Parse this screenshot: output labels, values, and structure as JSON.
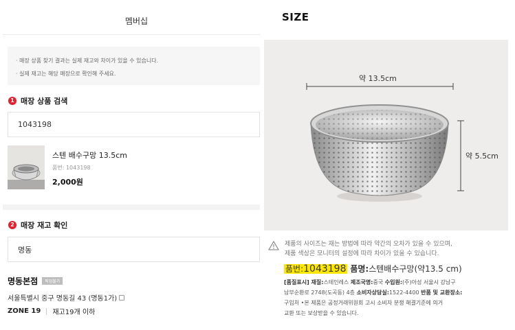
{
  "header": {
    "title": "멤버십"
  },
  "notice": {
    "lines": [
      "· 매장 상품 찾기 결과는 실제 재고와 차이가 있을 수 있습니다.",
      "· 실제 재고는 해당 매장으로 확인해 주세요."
    ]
  },
  "search_section": {
    "number": "1",
    "title": "매장 상품 검색",
    "input_value": "1043198"
  },
  "product": {
    "name": "스텐 배수구망 13.5cm",
    "code": "품번: 1043198",
    "price": "2,000원"
  },
  "stock_section": {
    "number": "2",
    "title": "매장 재고 확인",
    "input_value": "명동"
  },
  "store": {
    "name": "명동본점",
    "badge": "픽업불가",
    "address": "서울특별시 중구 명동길 43 (명동1가)",
    "zone": "ZONE 19",
    "stock": "재고19개 이하"
  },
  "size_panel": {
    "title": "SIZE",
    "width_label": "약 13.5cm",
    "height_label": "약 5.5cm",
    "caution_line1": "제품의 사이즈는 재는 방법에 따라 약간의 오차가 있을 수 있으며,",
    "caution_line2": "제품 색상은 모니터의 설정에 따라 차이가 있을 수 있습니다.",
    "code_prefix": "품번:",
    "code_value": "1043198",
    "name_prefix": "품명:",
    "name_value": "스텐배수구망(약13.5 cm)",
    "meta_line1_a": "[품질표시] 재질:",
    "meta_line1_b": "스테인레스",
    "meta_line1_c": "제조국명:",
    "meta_line1_d": "중국",
    "meta_line1_e": "수입원:",
    "meta_line1_f": "(주)아성 서울시 강남구",
    "meta_line2_a": "남부순환로 2748(도곡동) 4층",
    "meta_line2_b": "소비자상담실:",
    "meta_line2_c": "1522-4400",
    "meta_line2_d": "반품 및 교환장소:",
    "meta_line3": "구입처 •본 제품은 공정거래위원회 고시 소비자 분쟁 해결기준에 의거",
    "meta_line4": "교환 또는 보상받을 수 있습니다."
  },
  "colors": {
    "accent_red": "#e5202e",
    "highlight": "#ffe800"
  }
}
